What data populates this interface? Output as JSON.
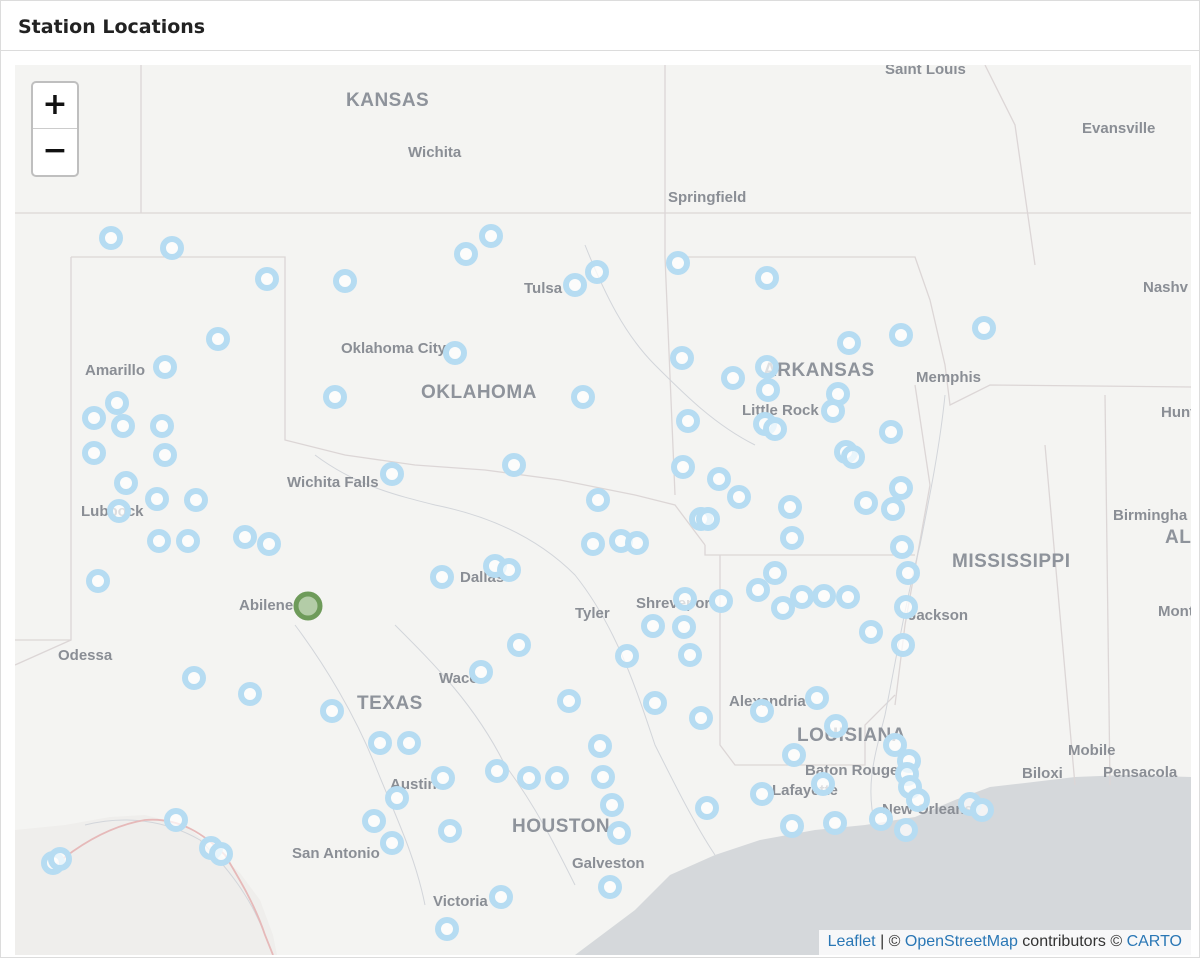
{
  "panel": {
    "title": "Station Locations"
  },
  "zoom": {
    "in_label": "+",
    "out_label": "−"
  },
  "attribution": {
    "leaflet": "Leaflet",
    "sep1": " | © ",
    "osm": "OpenStreetMap",
    "contributors": " contributors © ",
    "carto": "CARTO"
  },
  "colors": {
    "land": "#f4f4f2",
    "water": "#d5d8db",
    "border": "#dcd6d6",
    "river": "#c9cdd3",
    "station_marker": "#b6dcf2",
    "selected_marker": "#6e9b5a",
    "label": "#8b8f96"
  },
  "states": [
    "KANSAS",
    "OKLAHOMA",
    "ARKANSAS",
    "TEXAS",
    "LOUISIANA",
    "MISSISSIPPI",
    "HOUSTON",
    "AL"
  ],
  "cities": [
    "Saint Louis",
    "Evansville",
    "Wichita",
    "Springfield",
    "Tulsa",
    "Nashv",
    "Oklahoma City",
    "Amarillo",
    "Memphis",
    "Little Rock",
    "Hunts",
    "Wichita Falls",
    "Lubbock",
    "Birmingha",
    "Dallas",
    "Abilene",
    "Tyler",
    "Shreveport",
    "Jackson",
    "Montg",
    "Odessa",
    "Waco",
    "Alexandria",
    "Mobile",
    "Baton Rouge",
    "Biloxi",
    "Pensacola",
    "Austin",
    "Lafayette",
    "New Orleans",
    "San Antonio",
    "Galveston",
    "Victoria"
  ],
  "markers": {
    "station_count": 141,
    "selected": "Abilene"
  }
}
